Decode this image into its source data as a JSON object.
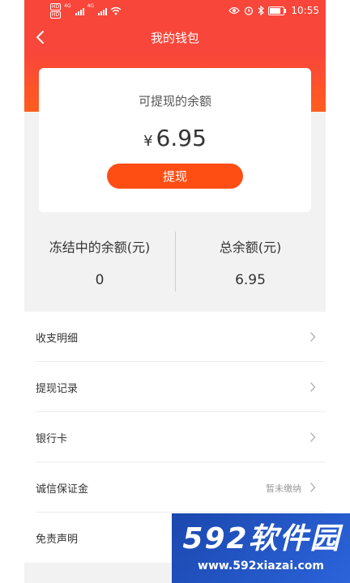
{
  "status_bar": {
    "hd_badges": [
      "HD",
      "HD"
    ],
    "network_labels": [
      "4G",
      "4G"
    ],
    "icons": [
      "signal-icon",
      "wifi-icon",
      "eye-icon",
      "alarm-icon",
      "bluetooth-icon",
      "battery-icon"
    ],
    "time": "10:55"
  },
  "header": {
    "title": "我的钱包",
    "back_icon": "chevron-left-icon",
    "background": "#f9463a"
  },
  "balance_card": {
    "label": "可提现的余额",
    "currency": "¥",
    "amount": "6.95",
    "withdraw_label": "提现",
    "button_color": "#ff4e14"
  },
  "stats": {
    "frozen_label": "冻结中的余额(元)",
    "frozen_value": "0",
    "total_label": "总余额(元)",
    "total_value": "6.95"
  },
  "menu": {
    "items": [
      {
        "label": "收支明细",
        "status": "",
        "icon": "chevron-right-icon"
      },
      {
        "label": "提现记录",
        "status": "",
        "icon": "chevron-right-icon"
      },
      {
        "label": "银行卡",
        "status": "",
        "icon": "chevron-right-icon"
      },
      {
        "label": "诚信保证金",
        "status": "暂未缴纳",
        "icon": "chevron-right-icon"
      },
      {
        "label": "免责声明",
        "status": "",
        "icon": "chevron-right-icon"
      }
    ]
  },
  "watermark": {
    "brand": "592软件园",
    "url": "www.592xiazai.com"
  },
  "colors": {
    "accent": "#f9463a",
    "button": "#ff4e14",
    "page_bg": "#f2f2f2"
  }
}
